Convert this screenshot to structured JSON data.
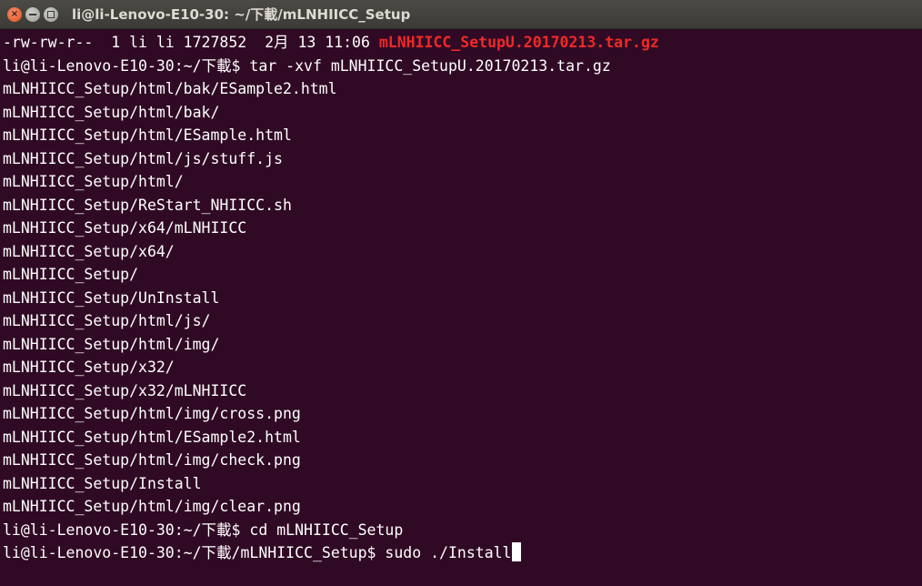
{
  "window": {
    "title": "li@li-Lenovo-E10-30: ~/下載/mLNHIICC_Setup",
    "close_label": "×"
  },
  "terminal": {
    "listing_prefix": "-rw-rw-r--  1 li li 1727852  2月 13 11:06 ",
    "listing_filename": "mLNHIICC_SetupU.20170213.tar.gz",
    "lines": [
      "li@li-Lenovo-E10-30:~/下載$ tar -xvf mLNHIICC_SetupU.20170213.tar.gz",
      "mLNHIICC_Setup/html/bak/ESample2.html",
      "mLNHIICC_Setup/html/bak/",
      "mLNHIICC_Setup/html/ESample.html",
      "mLNHIICC_Setup/html/js/stuff.js",
      "mLNHIICC_Setup/html/",
      "mLNHIICC_Setup/ReStart_NHIICC.sh",
      "mLNHIICC_Setup/x64/mLNHIICC",
      "mLNHIICC_Setup/x64/",
      "mLNHIICC_Setup/",
      "mLNHIICC_Setup/UnInstall",
      "mLNHIICC_Setup/html/js/",
      "mLNHIICC_Setup/html/img/",
      "mLNHIICC_Setup/x32/",
      "mLNHIICC_Setup/x32/mLNHIICC",
      "mLNHIICC_Setup/html/img/cross.png",
      "mLNHIICC_Setup/html/ESample2.html",
      "mLNHIICC_Setup/html/img/check.png",
      "mLNHIICC_Setup/Install",
      "mLNHIICC_Setup/html/img/clear.png",
      "li@li-Lenovo-E10-30:~/下載$ cd mLNHIICC_Setup"
    ],
    "current_prompt": "li@li-Lenovo-E10-30:~/下載/mLNHIICC_Setup$ sudo ./Install"
  },
  "colors": {
    "background": "#300a24",
    "text": "#ffffff",
    "archive_highlight": "#ef2929",
    "titlebar": "#3c3b37"
  }
}
